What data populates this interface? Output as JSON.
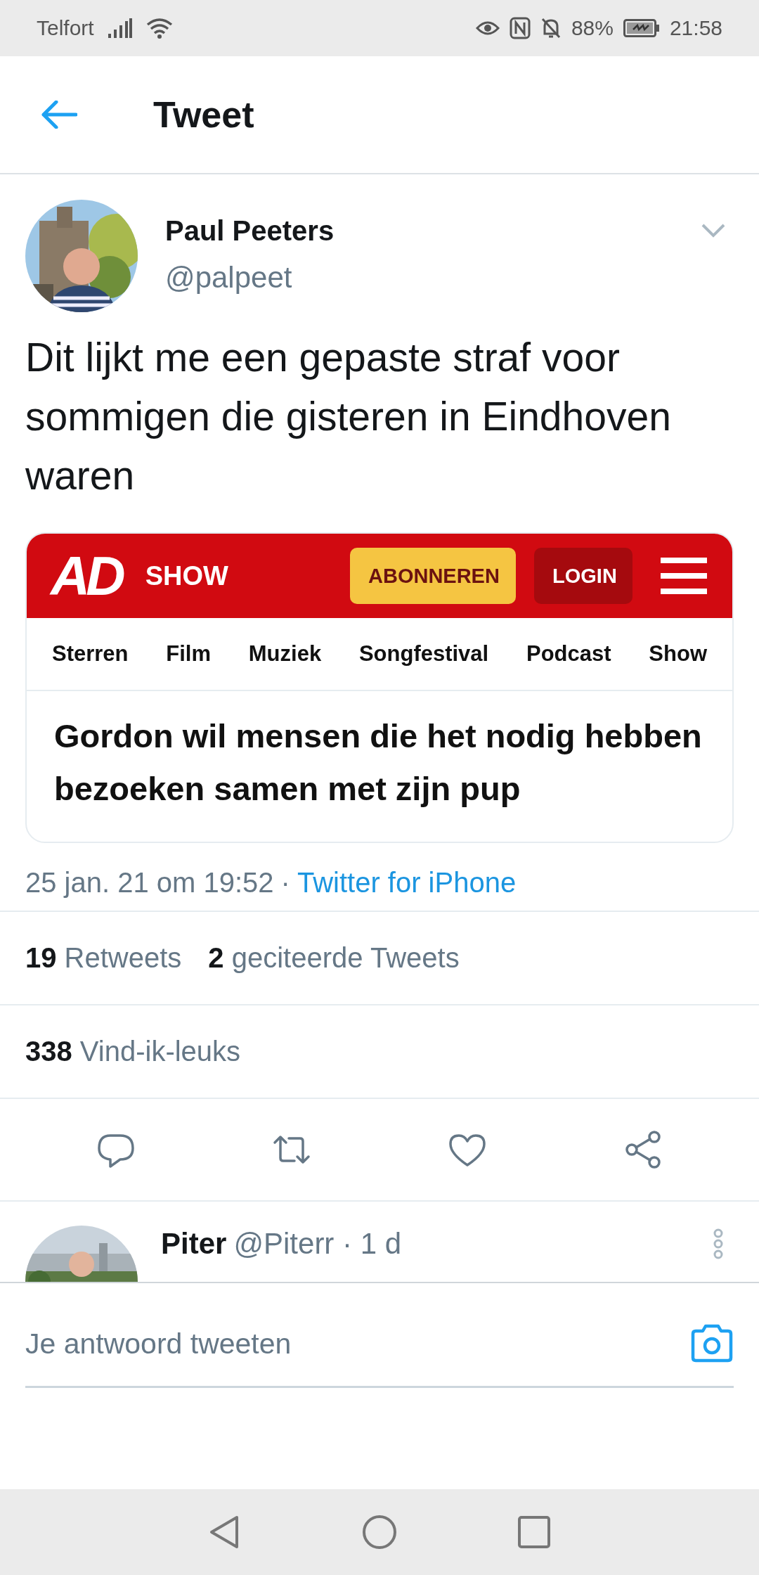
{
  "status_bar": {
    "carrier": "Telfort",
    "battery": "88%",
    "time": "21:58"
  },
  "header": {
    "title": "Tweet"
  },
  "tweet": {
    "author": {
      "name": "Paul Peeters",
      "handle": "@palpeet"
    },
    "text": "Dit lijkt me een gepaste straf voor sommigen die gisteren in Eindhoven waren",
    "embed": {
      "logo": "AD",
      "section": "SHOW",
      "buttons": [
        {
          "label": "ABONNEREN",
          "kind": "subscribe"
        },
        {
          "label": "LOGIN",
          "kind": "login"
        }
      ],
      "nav": [
        "Sterren",
        "Film",
        "Muziek",
        "Songfestival",
        "Podcast",
        "Show"
      ],
      "headline": "Gordon wil mensen die het nodig hebben bezoeken samen met zijn pup"
    },
    "timestamp": "25 jan. 21 om 19:52",
    "separator": "·",
    "source": "Twitter for iPhone",
    "stats": [
      [
        {
          "count": "19",
          "label": "Retweets"
        },
        {
          "count": "2",
          "label": "geciteerde Tweets"
        }
      ],
      [
        {
          "count": "338",
          "label": "Vind-ik-leuks"
        }
      ]
    ]
  },
  "reply": {
    "name": "Piter",
    "meta": "@Piterr · 1 d"
  },
  "compose": {
    "placeholder": "Je antwoord tweeten"
  }
}
